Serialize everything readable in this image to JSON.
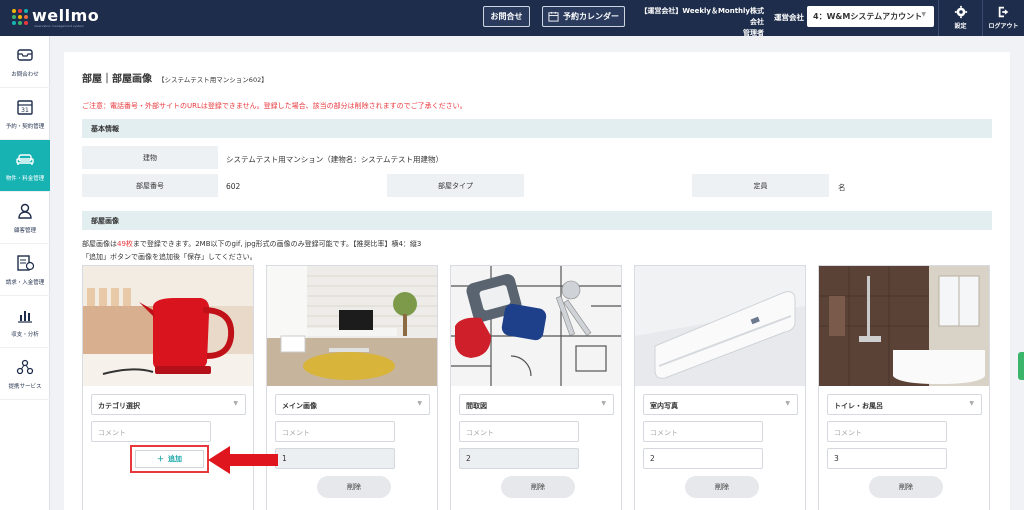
{
  "header": {
    "logo_text": "wellmo",
    "logo_sub": "reservation management system",
    "contact_label": "お問合せ",
    "calendar_label": "予約カレンダー",
    "company_line1": "【運営会社】Weekly＆Monthly株式会社",
    "company_line2": "管理者",
    "operator_label": "運営会社",
    "operator_value": "4：W&Mシステムアカウント",
    "settings_label": "設定",
    "logout_label": "ログアウト"
  },
  "sidebar": {
    "items": [
      {
        "label": "お問合わせ",
        "icon": "mail-icon"
      },
      {
        "label": "予約・契約管理",
        "icon": "calendar-icon"
      },
      {
        "label": "物件・料金管理",
        "icon": "bed-icon",
        "active": true
      },
      {
        "label": "顧客管理",
        "icon": "user-icon"
      },
      {
        "label": "請求・入金管理",
        "icon": "invoice-icon"
      },
      {
        "label": "収支・分析",
        "icon": "chart-icon"
      },
      {
        "label": "提携サービス",
        "icon": "network-icon"
      }
    ]
  },
  "page": {
    "title": "部屋｜部屋画像",
    "subtitle": "【システムテスト用マンション602】",
    "warning": "ご注意：電話番号・外部サイトのURLは登録できません。登録した場合、該当の部分は削除されますのでご了承ください。",
    "basic_section": "基本情報",
    "building_label": "建物",
    "building_value": "システムテスト用マンション（建物名：システムテスト用建物）",
    "room_no_label": "部屋番号",
    "room_no_value": "602",
    "room_type_label": "部屋タイプ",
    "room_type_value": "",
    "capacity_label": "定員",
    "capacity_value": "名",
    "image_section": "部屋画像",
    "info_pre": "部屋画像は",
    "info_count": "49枚",
    "info_post": "まで登録できます。2MB以下のgif, jpg形式の画像のみ登録可能です。【推奨比率】横4：縦3",
    "info_line2": "「追加」ボタンで画像を追加後「保存」してください。"
  },
  "images": [
    {
      "category": "カテゴリ選択",
      "comment_placeholder": "コメント",
      "add_label": "追加"
    },
    {
      "category": "メイン画像",
      "comment_placeholder": "コメント",
      "order": "1",
      "delete_label": "削除"
    },
    {
      "category": "間取図",
      "comment_placeholder": "コメント",
      "order": "2",
      "delete_label": "削除"
    },
    {
      "category": "室内写真",
      "comment_placeholder": "コメント",
      "order": "2",
      "delete_label": "削除"
    },
    {
      "category": "トイレ・お風呂",
      "comment_placeholder": "コメント",
      "order": "3",
      "delete_label": "削除"
    }
  ],
  "colors": {
    "header_bg": "#1e2d4b",
    "accent_teal": "#17b3b3",
    "warning_red": "#e8383d"
  }
}
